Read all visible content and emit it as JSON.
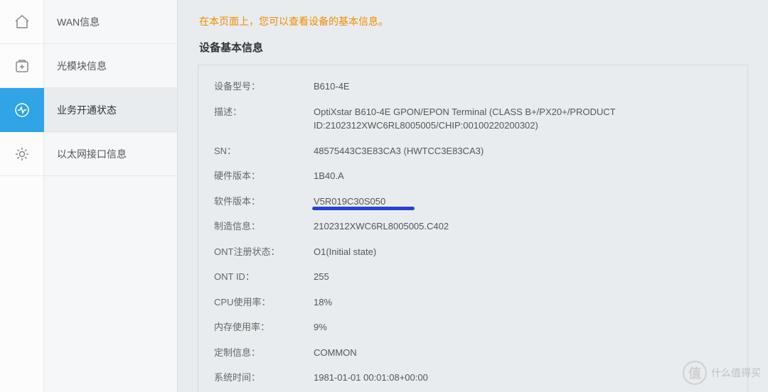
{
  "sidebar": {
    "items": [
      {
        "label": "WAN信息",
        "icon": "home-icon"
      },
      {
        "label": "光模块信息",
        "icon": "plus-box-icon"
      },
      {
        "label": "业务开通状态",
        "icon": "activity-icon"
      },
      {
        "label": "以太网接口信息",
        "icon": "gear-icon"
      }
    ]
  },
  "page": {
    "description": "在本页面上，您可以查看设备的基本信息。",
    "section_title": "设备基本信息"
  },
  "info": {
    "rows": [
      {
        "label": "设备型号：",
        "value": "B610-4E"
      },
      {
        "label": "描述：",
        "value": "OptiXstar B610-4E GPON/EPON Terminal (CLASS B+/PX20+/PRODUCT ID:2102312XWC6RL8005005/CHIP:00100220200302)"
      },
      {
        "label": "SN：",
        "value": "48575443C3E83CA3 (HWTCC3E83CA3)"
      },
      {
        "label": "硬件版本：",
        "value": "1B40.A"
      },
      {
        "label": "软件版本：",
        "value": "V5R019C30S050"
      },
      {
        "label": "制造信息：",
        "value": "2102312XWC6RL8005005.C402"
      },
      {
        "label": "ONT注册状态：",
        "value": "O1(Initial state)"
      },
      {
        "label": "ONT ID：",
        "value": "255"
      },
      {
        "label": "CPU使用率：",
        "value": "18%"
      },
      {
        "label": "内存使用率：",
        "value": "9%"
      },
      {
        "label": "定制信息：",
        "value": "COMMON"
      },
      {
        "label": "系统时间：",
        "value": "1981-01-01 00:01:08+00:00"
      }
    ]
  },
  "watermark": {
    "symbol": "值",
    "text": "什么值得买"
  }
}
